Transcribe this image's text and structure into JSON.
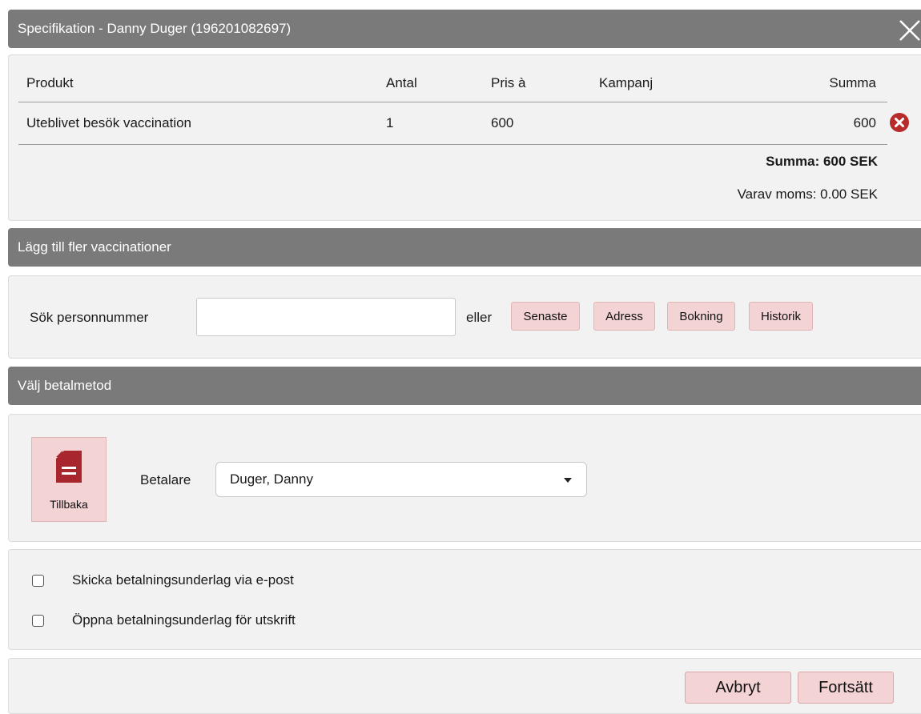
{
  "dialog": {
    "title": "Specifikation - Danny Duger (196201082697)",
    "close_icon": "close-icon"
  },
  "spec": {
    "headers": {
      "product": "Produkt",
      "quantity": "Antal",
      "price": "Pris à",
      "campaign": "Kampanj",
      "sum": "Summa"
    },
    "rows": [
      {
        "product": "Uteblivet besök vaccination",
        "quantity": "1",
        "price": "600",
        "campaign": "",
        "sum": "600"
      }
    ],
    "total": "Summa: 600 SEK",
    "vat": "Varav moms: 0.00 SEK"
  },
  "add_more": {
    "title": "Lägg till fler vaccinationer",
    "search_label": "Sök personnummer",
    "search_value": "",
    "or_label": "eller",
    "buttons": [
      "Senaste",
      "Adress",
      "Bokning",
      "Historik"
    ]
  },
  "payment": {
    "title": "Välj betalmetod",
    "back_label": "Tillbaka",
    "payer_label": "Betalare",
    "payer_value": "Duger, Danny"
  },
  "options": {
    "email": "Skicka betalningsunderlag via e-post",
    "print": "Öppna betalningsunderlag för utskrift"
  },
  "footer": {
    "cancel": "Avbryt",
    "continue": "Fortsätt"
  },
  "colors": {
    "header": "#7a7a7a",
    "panel": "#f2f2f2",
    "button_pink": "#f3d3d3",
    "remove_red": "#b72b2b"
  }
}
